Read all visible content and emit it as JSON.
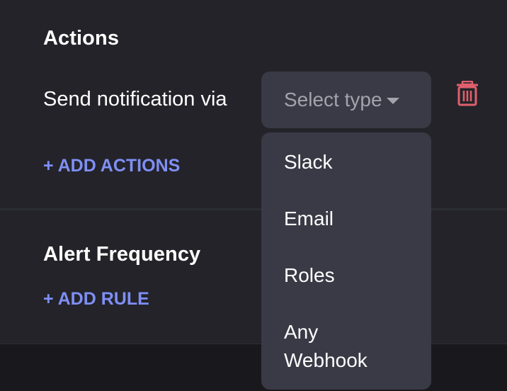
{
  "actions": {
    "heading": "Actions",
    "send_label": "Send notification via",
    "select_placeholder": "Select type",
    "add_actions": "+ ADD ACTIONS"
  },
  "alert_frequency": {
    "heading": "Alert Frequency",
    "add_rule": "+ ADD RULE"
  },
  "dropdown": {
    "options": [
      {
        "label": "Slack"
      },
      {
        "label": "Email"
      },
      {
        "label": "Roles"
      },
      {
        "label_line1": "Any",
        "label_line2": "Webhook"
      }
    ]
  },
  "icons": {
    "delete": "trash-icon",
    "caret": "chevron-down-icon"
  },
  "colors": {
    "accent_link": "#7f8ff4",
    "delete_icon": "#e0606e",
    "panel_bg": "#232329",
    "control_bg": "#3a3a46"
  }
}
